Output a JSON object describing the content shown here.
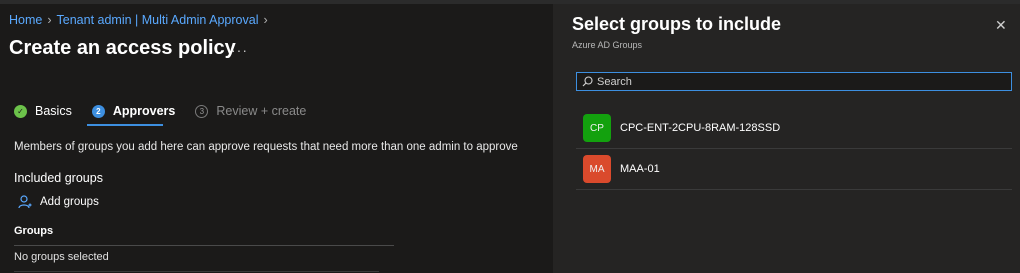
{
  "breadcrumb": {
    "home": "Home",
    "tenant": "Tenant admin | Multi Admin Approval"
  },
  "page": {
    "title": "Create an access policy",
    "more": "···"
  },
  "steps": [
    {
      "label": "Basics",
      "icon": "✓",
      "state": "done"
    },
    {
      "label": "Approvers",
      "icon": "2",
      "state": "active"
    },
    {
      "label": "Review + create",
      "icon": "3",
      "state": "todo"
    }
  ],
  "description": "Members of groups you add here can approve requests that need more than one admin to approve",
  "included": {
    "label": "Included groups",
    "add_label": "Add groups",
    "table_header": "Groups",
    "empty_text": "No groups selected"
  },
  "panel": {
    "title": "Select groups to include",
    "subtitle": "Azure AD Groups",
    "close": "✕",
    "search_placeholder": "Search",
    "groups": [
      {
        "initials": "CP",
        "name": "CPC-ENT-2CPU-8RAM-128SSD",
        "color": "#13a10e"
      },
      {
        "initials": "MA",
        "name": "MAA-01",
        "color": "#da4a2c"
      }
    ]
  },
  "colors": {
    "accent": "#3d8fe0",
    "link": "#5aa9ff",
    "done": "#6cc24a"
  }
}
